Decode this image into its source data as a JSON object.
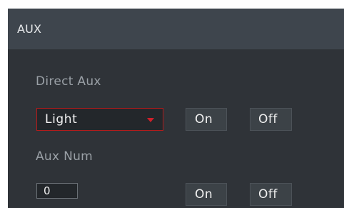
{
  "panel": {
    "title": "AUX"
  },
  "direct_aux": {
    "label": "Direct Aux",
    "selected": "Light",
    "on_label": "On",
    "off_label": "Off"
  },
  "aux_num": {
    "label": "Aux Num",
    "value": "0",
    "on_label": "On",
    "off_label": "Off"
  },
  "icons": {
    "dropdown": "caret-down-icon"
  },
  "colors": {
    "accent": "#d0202a",
    "panel_bg": "#2f3338",
    "header_bg": "#3e454d"
  }
}
